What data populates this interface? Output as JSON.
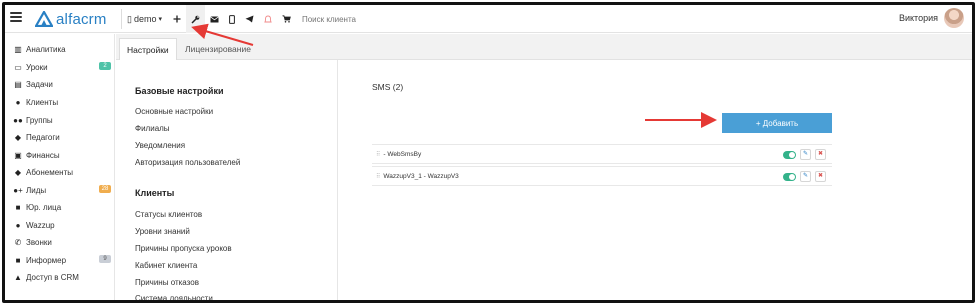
{
  "app": {
    "name": "alfacrm"
  },
  "topbar": {
    "org": "demo",
    "search_placeholder": "Поиск клиента",
    "user_name": "Виктория",
    "icons": [
      "plus-icon",
      "wrench-icon",
      "mail-icon",
      "phone-icon",
      "telegram-icon",
      "bell-icon",
      "cart-icon"
    ]
  },
  "sidebar": {
    "items": [
      {
        "label": "Аналитика",
        "icon": "analytics-icon"
      },
      {
        "label": "Уроки",
        "icon": "calendar-icon",
        "badge": "2",
        "badge_color": "#4fc3a8"
      },
      {
        "label": "Задачи",
        "icon": "tasks-icon"
      },
      {
        "label": "Клиенты",
        "icon": "user-icon"
      },
      {
        "label": "Группы",
        "icon": "group-icon"
      },
      {
        "label": "Педагоги",
        "icon": "graduation-cap-icon"
      },
      {
        "label": "Финансы",
        "icon": "money-icon"
      },
      {
        "label": "Абонементы",
        "icon": "tag-icon"
      },
      {
        "label": "Лиды",
        "icon": "user-plus-icon",
        "badge": "28",
        "badge_color": "#f0ad4e"
      },
      {
        "label": "Юр. лица",
        "icon": "briefcase-icon"
      },
      {
        "label": "Wazzup",
        "icon": "chat-icon"
      },
      {
        "label": "Звонки",
        "icon": "phone-call-icon"
      },
      {
        "label": "Информер",
        "icon": "informer-icon",
        "badge": "9",
        "badge_color": "#c9ced6"
      },
      {
        "label": "Доступ в CRM",
        "icon": "lock-icon"
      }
    ]
  },
  "tabs": [
    {
      "label": "Настройки",
      "active": true
    },
    {
      "label": "Лицензирование",
      "active": false
    }
  ],
  "settings_menu": {
    "section1": {
      "title": "Базовые настройки",
      "links": [
        "Основные настройки",
        "Филиалы",
        "Уведомления",
        "Авторизация пользователей"
      ]
    },
    "section2": {
      "title": "Клиенты",
      "links": [
        "Статусы клиентов",
        "Уровни знаний",
        "Причины пропуска уроков",
        "Кабинет клиента",
        "Причины отказов",
        "Система лояльности"
      ]
    }
  },
  "content": {
    "title": "SMS (2)",
    "add_button": "+ Добавить",
    "providers": [
      {
        "name": "- WebSmsBy",
        "enabled": true
      },
      {
        "name": "WazzupV3_1 - WazzupV3",
        "enabled": true
      }
    ]
  },
  "colors": {
    "brand": "#2980c4",
    "primary_button": "#4a9fd6",
    "toggle_on": "#33b28a",
    "annotation_arrow": "#e53935"
  }
}
